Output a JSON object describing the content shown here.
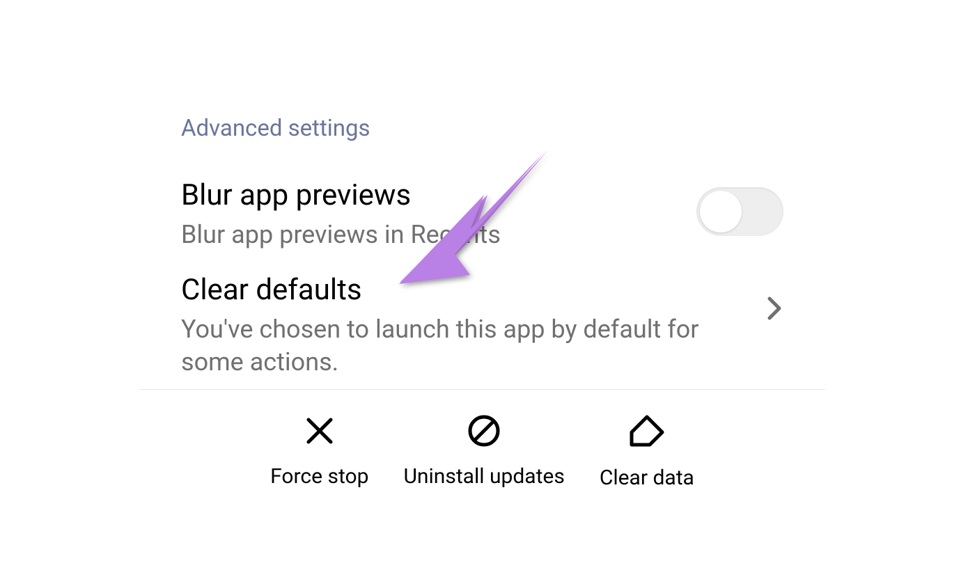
{
  "section": {
    "header": "Advanced settings"
  },
  "settings": {
    "blur_previews": {
      "title": "Blur app previews",
      "subtitle": "Blur app previews in Recents",
      "enabled": false
    },
    "clear_defaults": {
      "title": "Clear defaults",
      "subtitle": "You've chosen to launch this app by default for some actions."
    }
  },
  "actions": {
    "force_stop": "Force stop",
    "uninstall_updates": "Uninstall updates",
    "clear_data": "Clear data"
  }
}
